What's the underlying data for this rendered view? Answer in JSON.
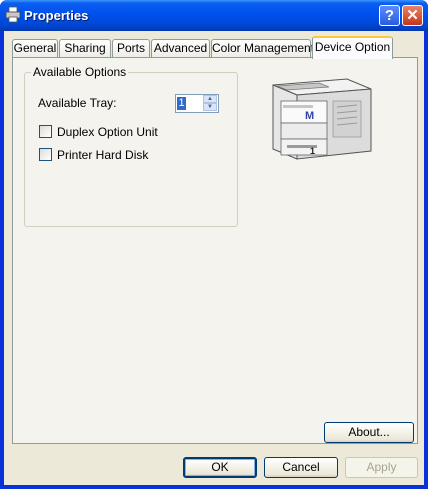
{
  "window": {
    "title": "Properties"
  },
  "title_buttons": {
    "help": "?",
    "close": "✕"
  },
  "tabs": [
    {
      "label": "General"
    },
    {
      "label": "Sharing"
    },
    {
      "label": "Ports"
    },
    {
      "label": "Advanced"
    },
    {
      "label": "Color Management"
    },
    {
      "label": "Device Option",
      "active": true
    }
  ],
  "options": {
    "group_title": "Available Options",
    "tray_label": "Available Tray:",
    "tray_value": "1",
    "duplex_label": "Duplex Option Unit",
    "duplex_checked": false,
    "hdd_label": "Printer Hard Disk",
    "hdd_checked": false
  },
  "printer_image": {
    "icon": "printer-illustration",
    "badge_letter": "M",
    "tray_number": "1"
  },
  "buttons": {
    "about": "About...",
    "ok": "OK",
    "cancel": "Cancel",
    "apply": "Apply"
  },
  "colors": {
    "title_bar": "#0054e3",
    "dialog_bg": "#ece9d8",
    "active_tab_highlight": "#ffc83c"
  }
}
